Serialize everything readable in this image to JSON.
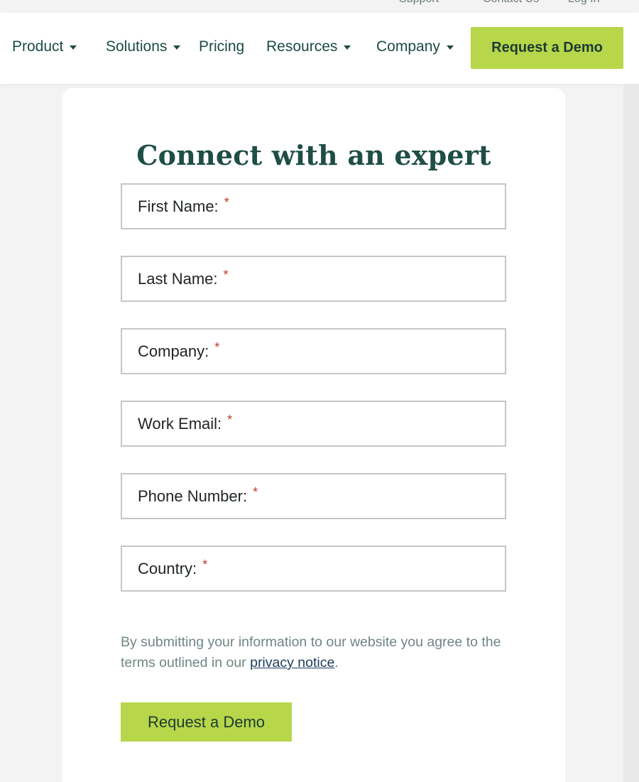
{
  "utility": {
    "support": "Support",
    "contact": "Contact Us",
    "login": "Log In"
  },
  "nav": {
    "items": [
      {
        "label": "Product",
        "dropdown": true
      },
      {
        "label": "Solutions",
        "dropdown": true
      },
      {
        "label": "Pricing",
        "dropdown": false
      },
      {
        "label": "Resources",
        "dropdown": true
      },
      {
        "label": "Company",
        "dropdown": true
      }
    ],
    "demo_label": "Request a Demo"
  },
  "form": {
    "title": "Connect with an expert",
    "fields": [
      {
        "label": "First Name:",
        "required": "*"
      },
      {
        "label": "Last Name:",
        "required": "*"
      },
      {
        "label": "Company:",
        "required": "*"
      },
      {
        "label": "Work Email:",
        "required": "*"
      },
      {
        "label": "Phone Number:",
        "required": "*"
      },
      {
        "label": "Country:",
        "required": "*"
      }
    ],
    "consent_text": "By submitting your information to our website you agree to the terms outlined in our",
    "privacy_link": "privacy notice",
    "consent_end": ".",
    "submit_label": "Request a Demo"
  },
  "colors": {
    "accent": "#b7d64a",
    "brand_text": "#1c4b45",
    "required": "#c0392b"
  }
}
